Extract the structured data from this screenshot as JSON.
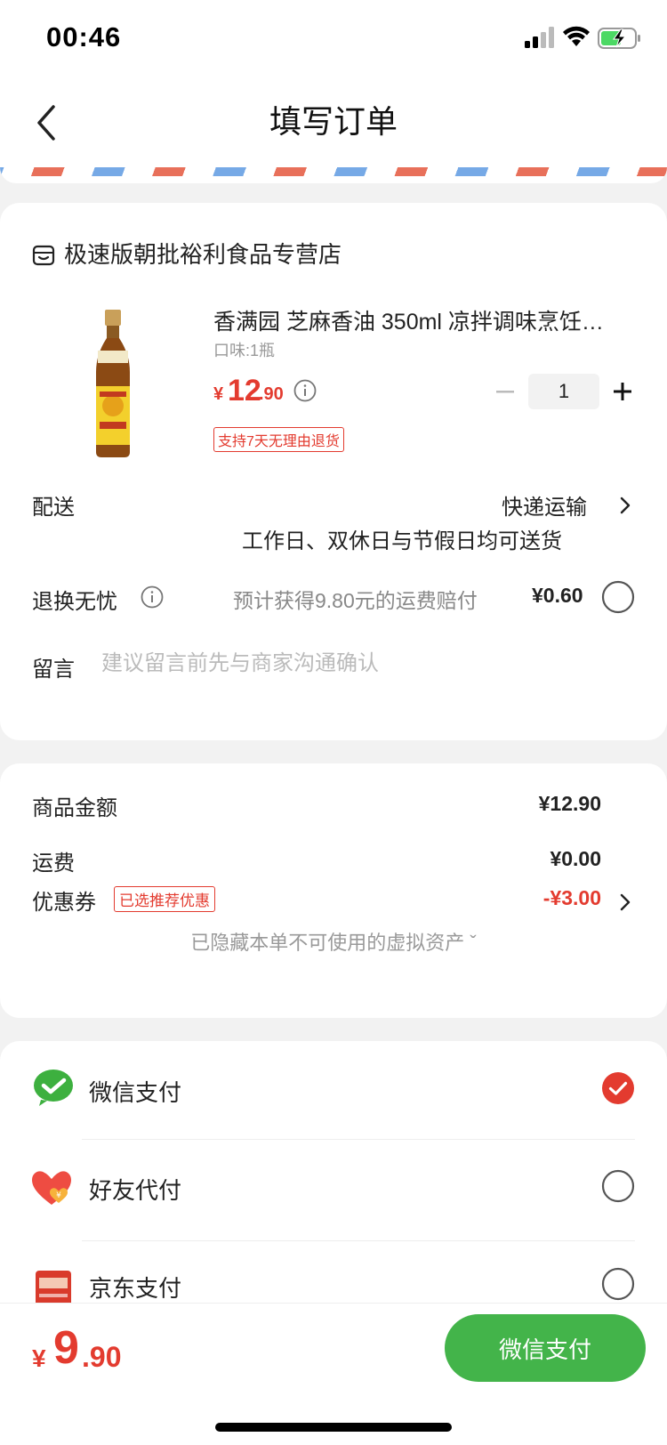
{
  "status_bar": {
    "time": "00:46"
  },
  "nav": {
    "title": "填写订单"
  },
  "order": {
    "shop_name": "极速版朝批裕利食品专营店",
    "product": {
      "title": "香满园 芝麻香油 350ml 凉拌调味烹饪…",
      "spec": "口味:1瓶",
      "price_symbol": "¥",
      "price_int": "12",
      "price_dec": ".90",
      "quantity": "1",
      "return_badge": "支持7天无理由退货"
    },
    "delivery": {
      "label": "配送",
      "value": "快递运输",
      "note": "工作日、双休日与节假日均可送货"
    },
    "worry_free": {
      "label": "退换无忧",
      "text": "预计获得9.80元的运费赔付",
      "price": "¥0.60"
    },
    "message": {
      "label": "留言",
      "placeholder": "建议留言前先与商家沟通确认"
    }
  },
  "summary": {
    "goods_label": "商品金额",
    "goods_value": "¥12.90",
    "shipping_label": "运费",
    "shipping_value": "¥0.00",
    "coupon_label": "优惠券",
    "coupon_badge": "已选推荐优惠",
    "coupon_value": "-¥3.00",
    "hidden_assets": "已隐藏本单不可使用的虚拟资产 ˇ"
  },
  "payment": {
    "methods": [
      {
        "label": "微信支付",
        "icon": "wechat-pay-icon",
        "selected": true
      },
      {
        "label": "好友代付",
        "icon": "friend-pay-icon",
        "selected": false
      },
      {
        "label": "京东支付",
        "icon": "jd-pay-icon",
        "selected": false
      }
    ]
  },
  "bottom": {
    "total_symbol": "¥",
    "total_int": "9",
    "total_dec": ".90",
    "pay_button": "微信支付"
  },
  "colors": {
    "accent_red": "#e33b2f",
    "wechat_green": "#43b44a",
    "stripe_red": "#e8705a",
    "stripe_blue": "#76a9e6"
  }
}
